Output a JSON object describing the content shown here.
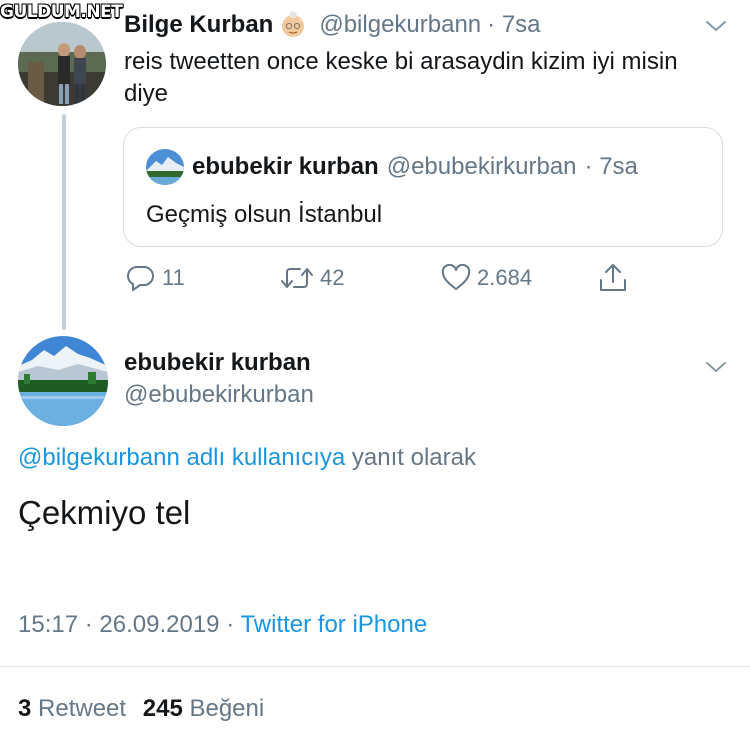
{
  "watermark": "GULDUM.NET",
  "tweet1": {
    "name": "Bilge Kurban",
    "emoji": "👵",
    "handle": "@bilgekurbann",
    "time": "· 7sa",
    "text": "reis tweetten once keske bi arasaydin kizim iyi misin diye",
    "quote": {
      "name": "ebubekir kurban",
      "handle": "@ebubekirkurban",
      "time": "· 7sa",
      "text": "Geçmiş olsun İstanbul"
    },
    "actions": {
      "replies": "11",
      "retweets": "42",
      "likes": "2.684"
    }
  },
  "tweet2": {
    "name": "ebubekir kurban",
    "handle": "@ebubekirkurban",
    "reply_to_link": "@bilgekurbann adlı kullanıcıya",
    "reply_to_suffix": "yanıt olarak",
    "text": "Çekmiyo tel",
    "time": "15:17",
    "sep1": "·",
    "date": "26.09.2019",
    "sep2": "·",
    "source": "Twitter for iPhone",
    "retweet_count": "3",
    "retweet_label": "Retweet",
    "like_count": "245",
    "like_label": "Beğeni"
  },
  "icons": [
    "chevron-down-icon",
    "reply-icon",
    "retweet-icon",
    "like-icon",
    "share-icon",
    "grandma-emoji-icon"
  ],
  "colors": {
    "link": "#1b95e0",
    "muted": "#657786",
    "text": "#14171a",
    "border": "#e1e8ed"
  }
}
